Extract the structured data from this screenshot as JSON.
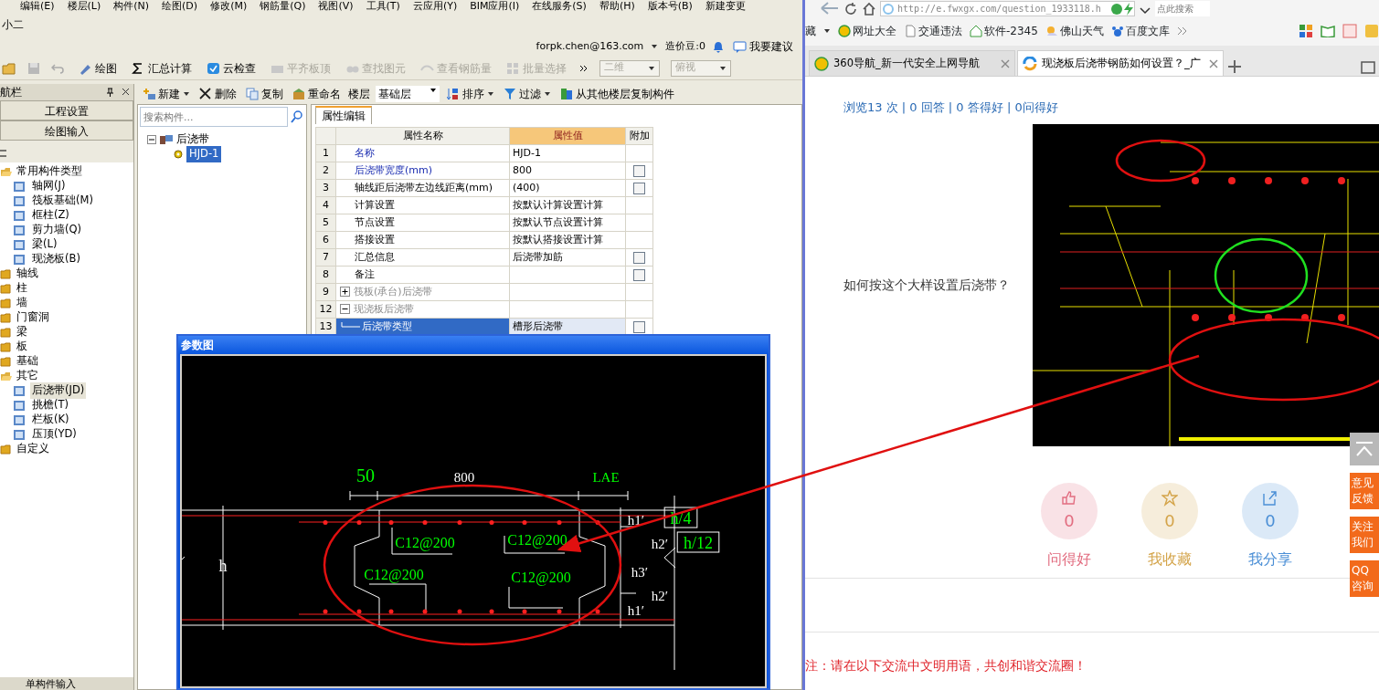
{
  "app": {
    "menu": [
      "编辑(E)",
      "楼层(L)",
      "构件(N)",
      "绘图(D)",
      "修改(M)",
      "钢筋量(Q)",
      "视图(V)",
      "工具(T)",
      "云应用(Y)",
      "BIM应用(I)",
      "在线服务(S)",
      "帮助(H)",
      "版本号(B)",
      "新建变更"
    ],
    "user_tab": "小二",
    "account": {
      "email": "forpk.chen@163.com",
      "beans": "造价豆:0",
      "suggest": "我要建议"
    },
    "toolbar": [
      {
        "label": "绘图",
        "disabled": false
      },
      {
        "label": "汇总计算",
        "disabled": false
      },
      {
        "label": "云检查",
        "disabled": false
      },
      {
        "label": "平齐板顶",
        "disabled": true
      },
      {
        "label": "查找图元",
        "disabled": true
      },
      {
        "label": "查看钢筋量",
        "disabled": true
      },
      {
        "label": "批量选择",
        "disabled": true
      }
    ],
    "view_selects": [
      {
        "label": "二维",
        "disabled": true
      },
      {
        "label": "俯视",
        "disabled": true
      }
    ],
    "nav": {
      "title": "航栏",
      "buttons": [
        "工程设置",
        "绘图输入"
      ],
      "tree": [
        {
          "label": "常用构件类型",
          "expanded": true,
          "children": [
            {
              "label": "轴网(J)",
              "selected": false
            },
            {
              "label": "筏板基础(M)",
              "selected": false
            },
            {
              "label": "框柱(Z)",
              "selected": false
            },
            {
              "label": "剪力墙(Q)",
              "selected": false
            },
            {
              "label": "梁(L)",
              "selected": false
            },
            {
              "label": "现浇板(B)",
              "selected": false
            }
          ]
        },
        {
          "label": "轴线",
          "expanded": false
        },
        {
          "label": "柱",
          "expanded": false
        },
        {
          "label": "墙",
          "expanded": false
        },
        {
          "label": "门窗洞",
          "expanded": false
        },
        {
          "label": "梁",
          "expanded": false
        },
        {
          "label": "板",
          "expanded": false
        },
        {
          "label": "基础",
          "expanded": false
        },
        {
          "label": "其它",
          "expanded": true,
          "children": [
            {
              "label": "后浇带(JD)",
              "selected": true
            },
            {
              "label": "挑檐(T)",
              "selected": false
            },
            {
              "label": "栏板(K)",
              "selected": false
            },
            {
              "label": "压顶(YD)",
              "selected": false
            }
          ]
        },
        {
          "label": "自定义",
          "expanded": false
        }
      ],
      "footer": "单构件输入"
    },
    "component_toolbar": [
      {
        "label": "新建",
        "dropdown": true
      },
      {
        "label": "删除",
        "dropdown": false
      },
      {
        "label": "复制",
        "dropdown": false
      },
      {
        "label": "重命名",
        "dropdown": false
      }
    ],
    "floor": {
      "label": "楼层",
      "value": "基础层"
    },
    "component_toolbar_2": [
      {
        "label": "排序",
        "dropdown": true
      },
      {
        "label": "过滤",
        "dropdown": true
      },
      {
        "label": "从其他楼层复制构件",
        "dropdown": false
      }
    ],
    "search": {
      "placeholder": "搜索构件..."
    },
    "component_tree": [
      {
        "label": "后浇带",
        "expanded": true,
        "children": [
          {
            "label": "HJD-1",
            "selected": true
          }
        ]
      }
    ],
    "properties": {
      "tab": "属性编辑",
      "columns": [
        "属性名称",
        "属性值",
        "附加"
      ],
      "rows": [
        {
          "num": "1",
          "name": "名称",
          "value": "HJD-1",
          "kind": "key"
        },
        {
          "num": "2",
          "name": "后浇带宽度(mm)",
          "value": "800",
          "kind": "key",
          "checked": false
        },
        {
          "num": "3",
          "name": "轴线距后浇带左边线距离(mm)",
          "value": "(400)",
          "kind": "plain",
          "checked": false
        },
        {
          "num": "4",
          "name": "计算设置",
          "value": "按默认计算设置计算",
          "kind": "plain"
        },
        {
          "num": "5",
          "name": "节点设置",
          "value": "按默认节点设置计算",
          "kind": "plain"
        },
        {
          "num": "6",
          "name": "搭接设置",
          "value": "按默认搭接设置计算",
          "kind": "plain"
        },
        {
          "num": "7",
          "name": "汇总信息",
          "value": "后浇带加筋",
          "kind": "plain",
          "checked": false
        },
        {
          "num": "8",
          "name": "备注",
          "kind": "plain",
          "checked": false
        },
        {
          "num": "9",
          "name": "筏板(承台)后浇带",
          "kind": "group",
          "expanded": false
        },
        {
          "num": "12",
          "name": "现浇板后浇带",
          "kind": "group",
          "expanded": true,
          "children": [
            {
              "num": "13",
              "name": "后浇带类型",
              "value": "槽形后浇带",
              "selected": true,
              "checked": false
            }
          ]
        }
      ]
    }
  },
  "dialog": {
    "title": "参数图",
    "labels": [
      {
        "text": "50",
        "color": "#00ff00",
        "boxed": false
      },
      {
        "text": "800",
        "color": "#ffffff",
        "boxed": false
      },
      {
        "text": "LAE",
        "color": "#00ff00",
        "boxed": false
      },
      {
        "text": "h",
        "color": "#ffffff",
        "boxed": false
      },
      {
        "text": "C12@200",
        "color": "#00ff00",
        "boxed": false
      },
      {
        "text": "C12@200",
        "color": "#00ff00",
        "boxed": false
      },
      {
        "text": "C12@200",
        "color": "#00ff00",
        "boxed": false
      },
      {
        "text": "C12@200",
        "color": "#00ff00",
        "boxed": false
      },
      {
        "text": "h1′",
        "color": "#ffffff",
        "boxed": false
      },
      {
        "text": "h/4",
        "color": "#00ff00",
        "boxed": true
      },
      {
        "text": "h2′",
        "color": "#ffffff",
        "boxed": false
      },
      {
        "text": "h/12",
        "color": "#00ff00",
        "boxed": true
      },
      {
        "text": "h3′",
        "color": "#ffffff",
        "boxed": false
      },
      {
        "text": "h2′",
        "color": "#ffffff",
        "boxed": false
      },
      {
        "text": "h1′",
        "color": "#ffffff",
        "boxed": false
      }
    ]
  },
  "browser": {
    "address": "http://e.fwxgx.com/question_1933118.h",
    "search": {
      "placeholder": "点此搜索"
    },
    "bookmarks": [
      "藏",
      "网址大全",
      "交通违法",
      "软件-2345",
      "佛山天气",
      "百度文库"
    ],
    "tabs": [
      {
        "title": "360导航_新一代安全上网导航",
        "selected": false
      },
      {
        "title": "现浇板后浇带钢筋如何设置？_广",
        "selected": true
      }
    ],
    "stats": "浏览13 次 | 0 回答 | 0 答得好 | 0问得好",
    "question": "如何按这个大样设置后浇带？",
    "actions": [
      {
        "count": "0",
        "label": "问得好",
        "color": "#e26d80"
      },
      {
        "count": "0",
        "label": "我收藏",
        "color": "#d4a44a"
      },
      {
        "count": "0",
        "label": "我分享",
        "color": "#4b8fd6"
      }
    ],
    "side_buttons": [
      "意见反馈",
      "关注我们",
      "QQ咨询"
    ],
    "notice": "注：请在以下交流中文明用语，共创和谐交流圈！"
  }
}
